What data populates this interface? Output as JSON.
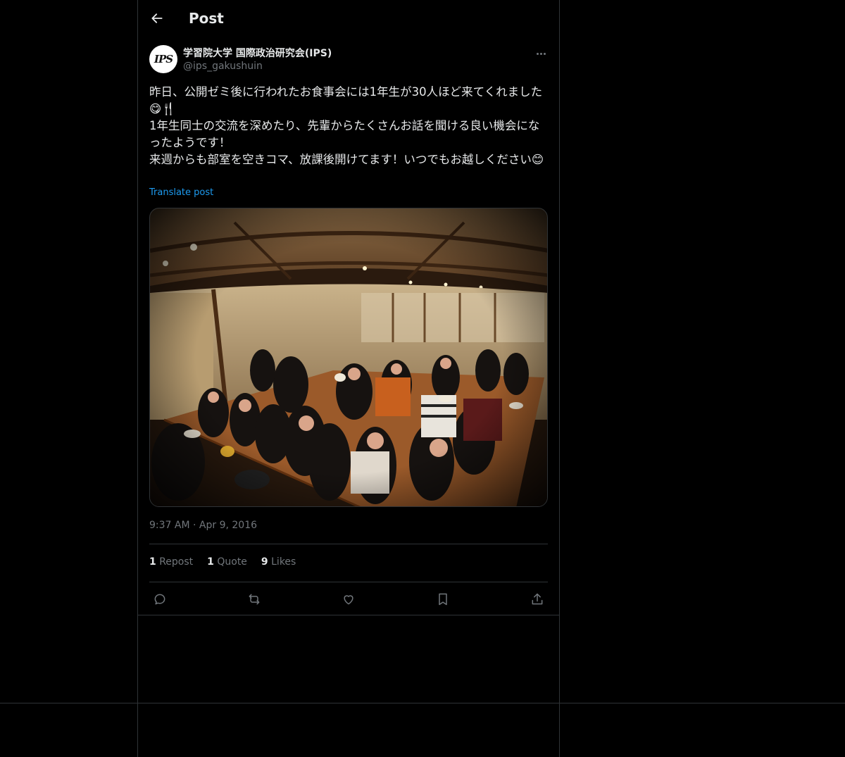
{
  "header": {
    "title": "Post"
  },
  "author": {
    "display_name": "学習院大学 国際政治研究会(IPS)",
    "handle": "@ips_gakushuin",
    "avatar_text": "IPS"
  },
  "post": {
    "text": "昨日、公開ゼミ後に行われたお食事会には1年生が30人ほど来てくれました😋🍴\n1年生同士の交流を深めたり、先輩からたくさんお話を聞ける良い機会になったようです！\n来週からも部室を空きコマ、放課後開けてます！いつでもお越しください😊",
    "translate_label": "Translate post",
    "timestamp": "9:37 AM · Apr 9, 2016"
  },
  "stats": {
    "reposts_count": "1",
    "reposts_label": "Repost",
    "quotes_count": "1",
    "quotes_label": "Quote",
    "likes_count": "9",
    "likes_label": "Likes"
  },
  "icons": {
    "back": "arrow-left-icon",
    "more": "more-horizontal-icon",
    "reply": "reply-icon",
    "repost": "repost-icon",
    "like": "heart-icon",
    "bookmark": "bookmark-icon",
    "share": "share-icon"
  }
}
